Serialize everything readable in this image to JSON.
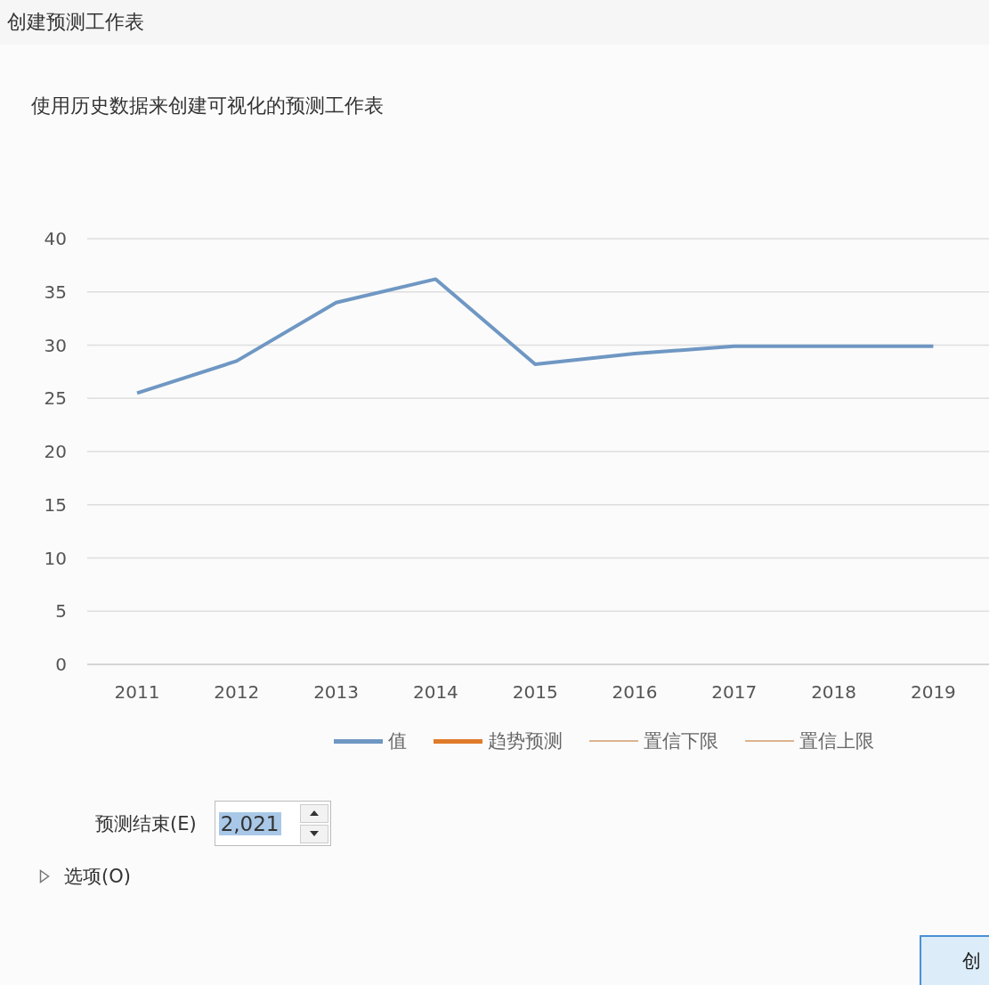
{
  "window": {
    "title": "创建预测工作表"
  },
  "description": "使用历史数据来创建可视化的预测工作表",
  "chart_data": {
    "type": "line",
    "grid": true,
    "categories": [
      "2011",
      "2012",
      "2013",
      "2014",
      "2015",
      "2016",
      "2017",
      "2018",
      "2019"
    ],
    "ylim": [
      0,
      40
    ],
    "yticks": [
      0,
      5,
      10,
      15,
      20,
      25,
      30,
      35,
      40
    ],
    "series": [
      {
        "name": "值",
        "color": "#6f97c3",
        "values": [
          25.5,
          28.5,
          34,
          36.2,
          28.2,
          29.2,
          29.9,
          29.9,
          29.9
        ]
      },
      {
        "name": "趋势预测",
        "color": "#e07b2a",
        "values": [
          null,
          null,
          null,
          null,
          null,
          null,
          null,
          null,
          null
        ]
      },
      {
        "name": "置信下限",
        "color": "#dcb48e",
        "values": [
          null,
          null,
          null,
          null,
          null,
          null,
          null,
          null,
          null
        ]
      },
      {
        "name": "置信上限",
        "color": "#dcb48e",
        "values": [
          null,
          null,
          null,
          null,
          null,
          null,
          null,
          null,
          null
        ]
      }
    ]
  },
  "forecast_end": {
    "label": "预测结束(E)",
    "value": "2,021"
  },
  "options": {
    "label": "选项(O)",
    "expanded": false
  },
  "buttons": [
    "创"
  ]
}
